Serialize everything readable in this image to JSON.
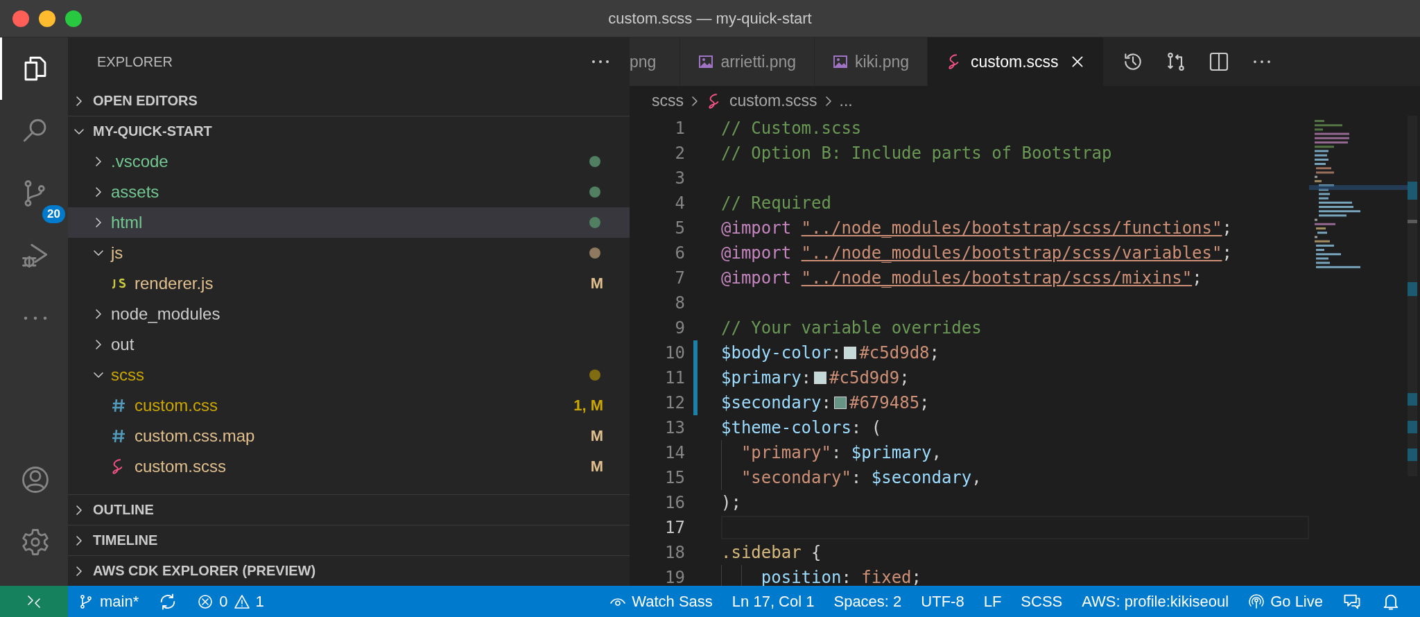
{
  "window": {
    "title": "custom.scss — my-quick-start"
  },
  "activity_bar": [
    {
      "kind": "explorer",
      "selected": true
    },
    {
      "kind": "search",
      "selected": false
    },
    {
      "kind": "source-control",
      "selected": false,
      "badge": "20"
    },
    {
      "kind": "run-debug",
      "selected": false
    },
    {
      "kind": "more",
      "selected": false
    },
    {
      "kind": "account",
      "selected": false
    },
    {
      "kind": "settings",
      "selected": false
    }
  ],
  "sidebar": {
    "title": "EXPLORER",
    "sections": [
      {
        "title": "OPEN EDITORS",
        "expanded": false
      },
      {
        "title": "MY-QUICK-START",
        "expanded": true,
        "items": [
          {
            "label": ".vscode",
            "kind": "folder",
            "expanded": false,
            "selected": false,
            "color": "#73c991",
            "dot": true
          },
          {
            "label": "assets",
            "kind": "folder",
            "expanded": false,
            "selected": false,
            "color": "#73c991",
            "dot": true
          },
          {
            "label": "html",
            "kind": "folder",
            "expanded": false,
            "selected": true,
            "color": "#73c991",
            "dot": true
          },
          {
            "label": "js",
            "kind": "folder",
            "expanded": true,
            "selected": false,
            "color": "#e2c08d",
            "dot": true,
            "children": [
              {
                "label": "renderer.js",
                "kind": "js",
                "selected": false,
                "color": "#e2c08d",
                "badge": "M"
              }
            ]
          },
          {
            "label": "node_modules",
            "kind": "folder",
            "expanded": false,
            "selected": false,
            "color": "#cccccc"
          },
          {
            "label": "out",
            "kind": "folder",
            "expanded": false,
            "selected": false,
            "color": "#cccccc"
          },
          {
            "label": "scss",
            "kind": "folder",
            "expanded": true,
            "selected": false,
            "color": "#cca700",
            "dot": true,
            "children": [
              {
                "label": "custom.css",
                "kind": "css",
                "selected": false,
                "color": "#cca700",
                "badge": "1, M"
              },
              {
                "label": "custom.css.map",
                "kind": "css",
                "selected": false,
                "color": "#e2c08d",
                "badge": "M"
              },
              {
                "label": "custom.scss",
                "kind": "sass",
                "selected": false,
                "color": "#e2c08d",
                "badge": "M"
              }
            ]
          }
        ]
      },
      {
        "title": "OUTLINE",
        "expanded": false
      },
      {
        "title": "TIMELINE",
        "expanded": false
      },
      {
        "title": "AWS CDK EXPLORER (PREVIEW)",
        "expanded": false
      }
    ]
  },
  "tabs": [
    {
      "label": "png",
      "selected": false
    },
    {
      "label": "arrietti.png",
      "kind": "image",
      "selected": false
    },
    {
      "label": "kiki.png",
      "kind": "image",
      "selected": false
    },
    {
      "label": "custom.scss",
      "kind": "sass",
      "selected": true
    }
  ],
  "editor_actions": [
    {
      "kind": "history"
    },
    {
      "kind": "compare"
    },
    {
      "kind": "split"
    },
    {
      "kind": "more"
    }
  ],
  "breadcrumbs": [
    {
      "label": "scss",
      "kind": "folder"
    },
    {
      "label": "custom.scss",
      "kind": "sass"
    },
    {
      "label": "...",
      "kind": "more"
    }
  ],
  "code": [
    {
      "number": "1",
      "tokens": [
        {
          "kind": "comment",
          "text": "// Custom.scss"
        }
      ]
    },
    {
      "number": "2",
      "tokens": [
        {
          "kind": "comment",
          "text": "// Option B: Include parts of Bootstrap"
        }
      ]
    },
    {
      "number": "3"
    },
    {
      "number": "4",
      "tokens": [
        {
          "kind": "comment",
          "text": "// Required"
        }
      ]
    },
    {
      "number": "5",
      "tokens": [
        {
          "kind": "keyword",
          "text": "@import"
        },
        {
          "kind": "link",
          "text": "\"../node_modules/bootstrap/scss/functions\""
        },
        {
          "kind": "plain",
          "text": ";"
        }
      ]
    },
    {
      "number": "6",
      "tokens": [
        {
          "kind": "keyword",
          "text": "@import"
        },
        {
          "kind": "link",
          "text": "\"../node_modules/bootstrap/scss/variables\""
        },
        {
          "kind": "plain",
          "text": ";"
        }
      ]
    },
    {
      "number": "7",
      "tokens": [
        {
          "kind": "keyword",
          "text": "@import"
        },
        {
          "kind": "link",
          "text": "\"../node_modules/bootstrap/scss/mixins\""
        },
        {
          "kind": "plain",
          "text": ";"
        }
      ]
    },
    {
      "number": "8"
    },
    {
      "number": "9",
      "tokens": [
        {
          "kind": "comment",
          "text": "// Your variable overrides"
        }
      ]
    },
    {
      "number": "10",
      "modified": true,
      "tokens": [
        {
          "kind": "variable",
          "text": "$body-color"
        },
        {
          "kind": "plain",
          "text": ":"
        },
        {
          "kind": "swatch",
          "color": "#c5d9d8"
        },
        {
          "kind": "string",
          "text": "#c5d9d8"
        },
        {
          "kind": "plain",
          "text": ";"
        }
      ]
    },
    {
      "number": "11",
      "modified": true,
      "tokens": [
        {
          "kind": "variable",
          "text": "$primary"
        },
        {
          "kind": "plain",
          "text": ":"
        },
        {
          "kind": "swatch",
          "color": "#c5d9d9"
        },
        {
          "kind": "string",
          "text": "#c5d9d9"
        },
        {
          "kind": "plain",
          "text": ";"
        }
      ]
    },
    {
      "number": "12",
      "modified": true,
      "tokens": [
        {
          "kind": "variable",
          "text": "$secondary"
        },
        {
          "kind": "plain",
          "text": ":"
        },
        {
          "kind": "swatch",
          "color": "#679485"
        },
        {
          "kind": "string",
          "text": "#679485"
        },
        {
          "kind": "plain",
          "text": ";"
        }
      ]
    },
    {
      "number": "13",
      "tokens": [
        {
          "kind": "variable",
          "text": "$theme-colors"
        },
        {
          "kind": "plain",
          "text": ": ("
        }
      ]
    },
    {
      "number": "14",
      "tokens": [
        {
          "kind": "string",
          "text": "  \"primary\""
        },
        {
          "kind": "plain",
          "text": ": "
        },
        {
          "kind": "variable",
          "text": "$primary"
        },
        {
          "kind": "plain",
          "text": ","
        }
      ]
    },
    {
      "number": "15",
      "tokens": [
        {
          "kind": "string",
          "text": "  \"secondary\""
        },
        {
          "kind": "plain",
          "text": ": "
        },
        {
          "kind": "variable",
          "text": "$secondary"
        },
        {
          "kind": "plain",
          "text": ","
        }
      ]
    },
    {
      "number": "16",
      "tokens": [
        {
          "kind": "plain",
          "text": ");"
        }
      ]
    },
    {
      "number": "17",
      "current": true
    },
    {
      "number": "18",
      "tokens": [
        {
          "kind": "selector",
          "text": ".sidebar"
        },
        {
          "kind": "plain",
          "text": " {"
        }
      ]
    },
    {
      "number": "19",
      "tokens": [
        {
          "kind": "variable",
          "text": "    position"
        },
        {
          "kind": "plain",
          "text": ": "
        },
        {
          "kind": "string",
          "text": "fixed"
        },
        {
          "kind": "plain",
          "text": ";"
        }
      ]
    }
  ],
  "status_bar": [
    {
      "kind": "remote"
    },
    {
      "kind": "branch",
      "text": "main*"
    },
    {
      "kind": "sync"
    },
    {
      "kind": "problems",
      "errors": "0",
      "warnings": "1"
    },
    {
      "kind": "watch",
      "text": "Watch Sass"
    },
    {
      "kind": "text",
      "text": "Ln 17, Col 1"
    },
    {
      "kind": "text",
      "text": "Spaces: 2"
    },
    {
      "kind": "text",
      "text": "UTF-8"
    },
    {
      "kind": "text",
      "text": "LF"
    },
    {
      "kind": "text",
      "text": "SCSS"
    },
    {
      "kind": "text",
      "text": "AWS: profile:kikiseoul"
    },
    {
      "kind": "golive",
      "text": "Go Live"
    },
    {
      "kind": "feedback"
    },
    {
      "kind": "bell"
    }
  ]
}
